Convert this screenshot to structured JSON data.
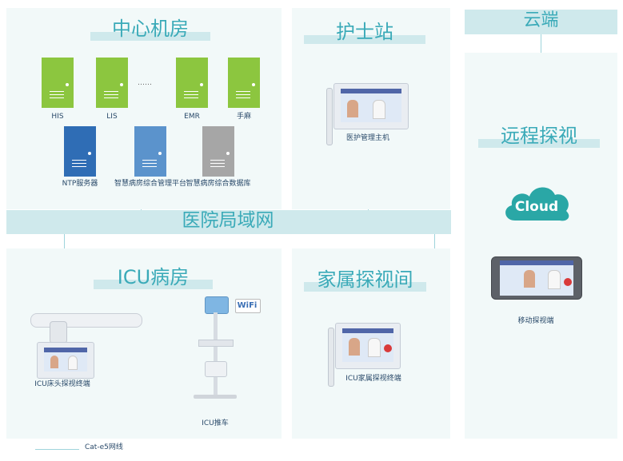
{
  "sections": {
    "datacenter": {
      "title": "中心机房"
    },
    "nurse_station": {
      "title": "护士站"
    },
    "cloud": {
      "title": "云端"
    },
    "remote_visit": {
      "title": "远程探视"
    },
    "lan": {
      "title": "医院局域网"
    },
    "icu_ward": {
      "title": "ICU病房"
    },
    "family_room": {
      "title": "家属探视间"
    }
  },
  "servers_top": [
    {
      "label": "HIS",
      "color": "#8cc63f"
    },
    {
      "label": "LIS",
      "color": "#8cc63f"
    },
    {
      "label": "EMR",
      "color": "#8cc63f"
    },
    {
      "label": "手麻",
      "color": "#8cc63f"
    }
  ],
  "ellipsis": "……",
  "servers_bottom": [
    {
      "label": "NTP服务器",
      "color": "#2f6db5"
    },
    {
      "label": "智慧病房综合管理平台",
      "color": "#5b93cc"
    },
    {
      "label": "智慧病房综合数据库",
      "color": "#a6a6a6"
    }
  ],
  "devices": {
    "nurse_host": "医护管理主机",
    "icu_bedside": "ICU床头探视终端",
    "icu_cart": "ICU推车",
    "family_terminal": "ICU家属探视终端",
    "mobile": "移动探视端",
    "cloud_logo": "Cloud",
    "wifi_logo": "WiFi"
  },
  "legend": {
    "label": "Cat-e5网线"
  },
  "colors": {
    "title": "#3aaab8",
    "panel": "#f2f9f9",
    "band": "#cfe9ec",
    "link": "#9fd4dc",
    "cloud": "#2aa7a6"
  }
}
